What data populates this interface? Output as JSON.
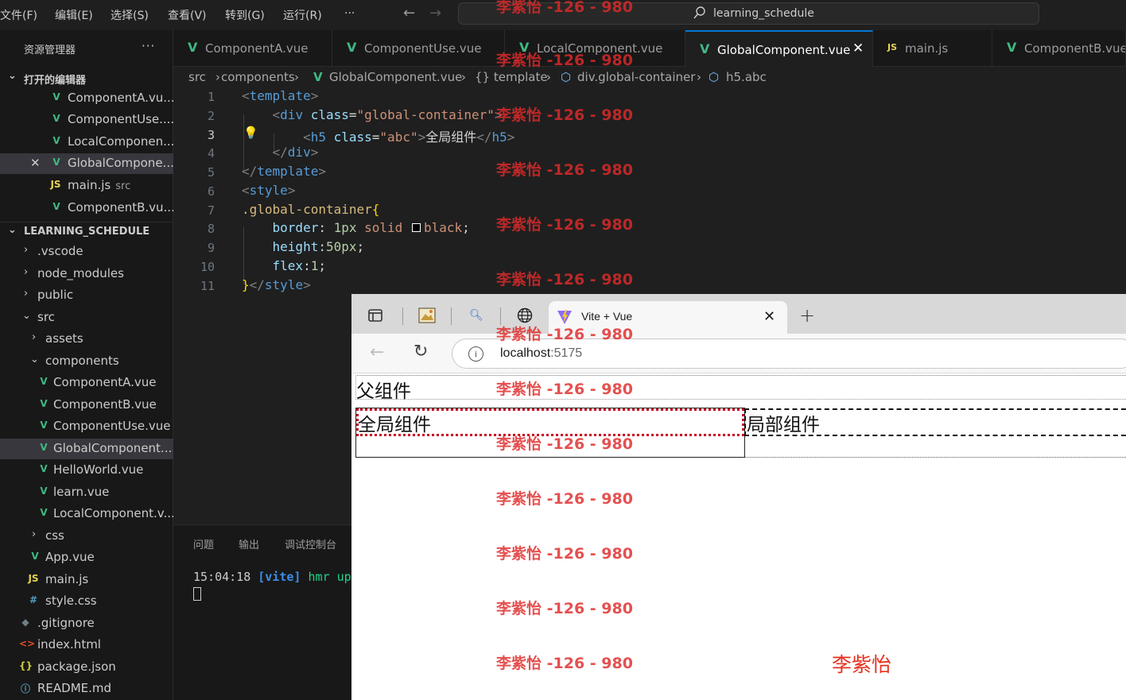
{
  "menubar": {
    "items": [
      "文件(F)",
      "编辑(E)",
      "选择(S)",
      "查看(V)",
      "转到(G)",
      "运行(R)",
      "···"
    ],
    "search": "learning_schedule"
  },
  "sidebar": {
    "title": "资源管理器",
    "more": "···",
    "open_editors": {
      "header": "打开的编辑器",
      "items": [
        {
          "icon": "vue-icon",
          "label": "ComponentA.vu..."
        },
        {
          "icon": "vue-icon",
          "label": "ComponentUse...."
        },
        {
          "icon": "vue-icon",
          "label": "LocalComponen..."
        },
        {
          "icon": "vue-icon",
          "label": "GlobalCompone..."
        },
        {
          "icon": "js-icon",
          "label": "main.js",
          "hint": "src"
        },
        {
          "icon": "vue-icon",
          "label": "ComponentB.vu..."
        }
      ]
    },
    "project": {
      "header": "LEARNING_SCHEDULE",
      "items": [
        {
          "label": ".vscode"
        },
        {
          "label": "node_modules"
        },
        {
          "label": "public"
        },
        {
          "label": "src"
        },
        {
          "label": "assets"
        },
        {
          "label": "components"
        },
        {
          "label": "ComponentA.vue"
        },
        {
          "label": "ComponentB.vue"
        },
        {
          "label": "ComponentUse.vue"
        },
        {
          "label": "GlobalComponent...."
        },
        {
          "label": "HelloWorld.vue"
        },
        {
          "label": "learn.vue"
        },
        {
          "label": "LocalComponent.v..."
        },
        {
          "label": "css"
        },
        {
          "label": "App.vue"
        },
        {
          "label": "main.js"
        },
        {
          "label": "style.css"
        },
        {
          "label": ".gitignore"
        },
        {
          "label": "index.html"
        },
        {
          "label": "package.json"
        },
        {
          "label": "README.md"
        }
      ]
    }
  },
  "tabs": [
    {
      "label": "ComponentA.vue",
      "icon": "vue-icon"
    },
    {
      "label": "ComponentUse.vue",
      "icon": "vue-icon"
    },
    {
      "label": "LocalComponent.vue",
      "icon": "vue-icon"
    },
    {
      "label": "GlobalComponent.vue",
      "icon": "vue-icon",
      "active": true
    },
    {
      "label": "main.js",
      "icon": "js-icon"
    },
    {
      "label": "ComponentB.vue",
      "icon": "vue-icon"
    }
  ],
  "breadcrumb": [
    "src",
    "components",
    "GlobalComponent.vue",
    "{} template",
    "div.global-container",
    "h5.abc"
  ],
  "editor": {
    "line_numbers": [
      "1",
      "2",
      "3",
      "4",
      "5",
      "6",
      "7",
      "8",
      "9",
      "10",
      "11"
    ],
    "lines": [
      "<template>",
      "    <div class=\"global-container\">",
      "        <h5 class=\"abc\">全局组件</h5>",
      "    </div>",
      "</template>",
      "<style>",
      ".global-container{",
      "    border: 1px solid black;",
      "    height:50px;",
      "    flex:1;",
      "}</style>"
    ]
  },
  "panel": {
    "tabs": [
      "问题",
      "输出",
      "调试控制台"
    ],
    "terminal": {
      "time": "15:04:18",
      "tag": "[vite]",
      "message": "hmr up"
    }
  },
  "browser": {
    "tab_title": "Vite + Vue",
    "url_host": "localhost",
    "url_port": ":5175",
    "page": {
      "parent_title": "父组件",
      "global_title": "全局组件",
      "local_title": "局部组件",
      "signature": "李紫怡"
    }
  },
  "watermark": "李紫怡 -126 - 980",
  "colors": {
    "accent": "#0078d4",
    "vue_green": "#41b883",
    "watermark_red": "#e02a2a"
  }
}
